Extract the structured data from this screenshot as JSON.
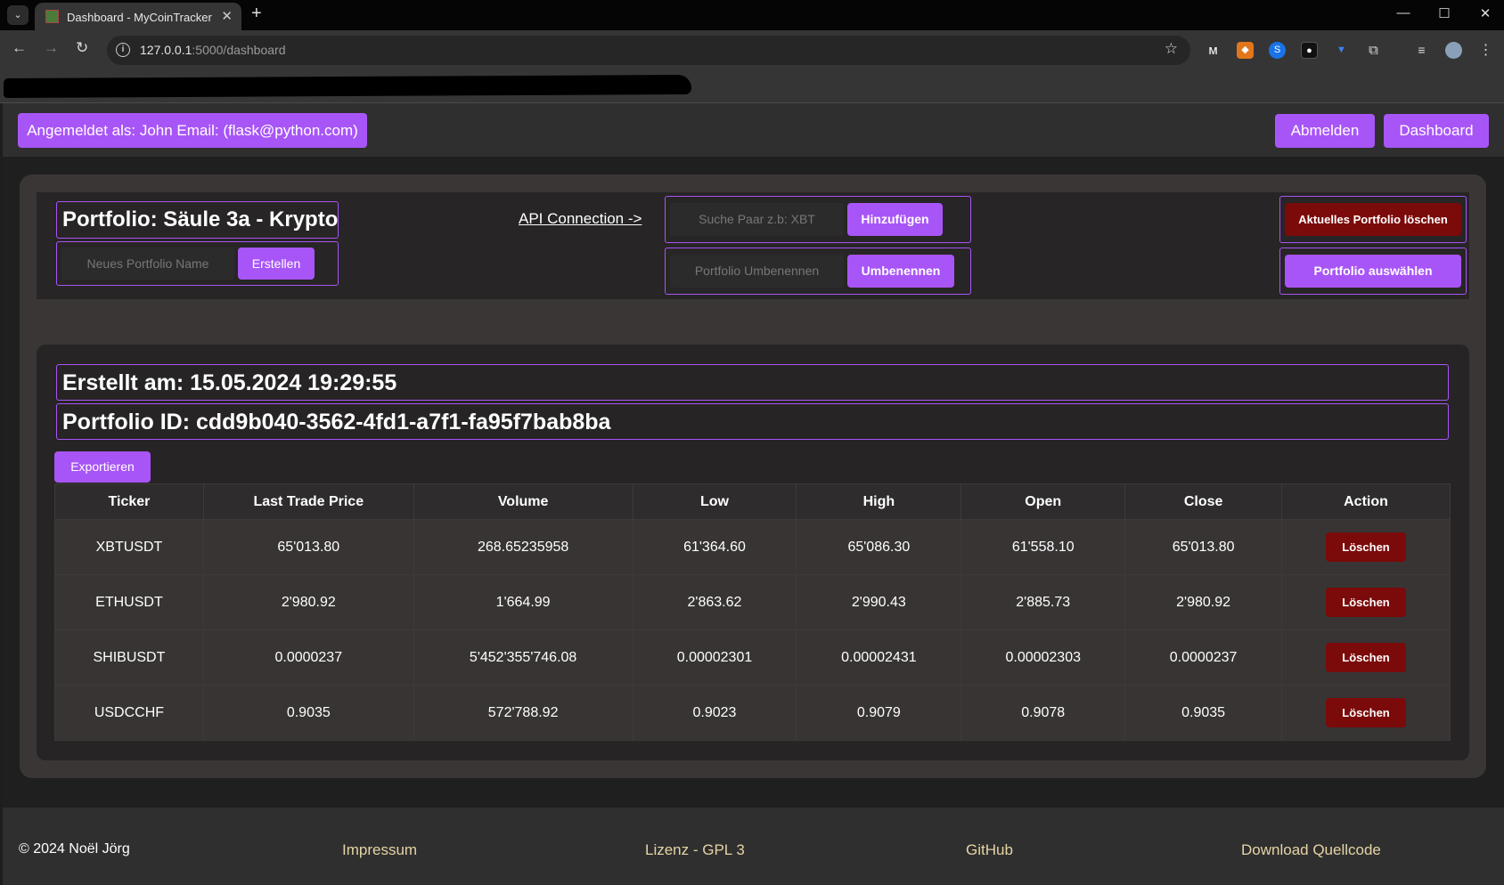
{
  "browser": {
    "tab_title": "Dashboard - MyCoinTracker",
    "url_host": "127.0.0.1",
    "url_path": ":5000/dashboard"
  },
  "header": {
    "user_label": "Angemeldet als: John Email: (flask@python.com)",
    "logout_label": "Abmelden",
    "dashboard_label": "Dashboard"
  },
  "portfolio": {
    "title": "Portfolio: Säule 3a - Krypto",
    "new_name_placeholder": "Neues Portfolio Name",
    "create_label": "Erstellen",
    "api_link": "API Connection ->",
    "search_placeholder": "Suche Paar z.b: XBT",
    "add_label": "Hinzufügen",
    "rename_placeholder": "Portfolio Umbenennen",
    "rename_label": "Umbenennen",
    "delete_label": "Aktuelles Portfolio löschen",
    "select_label": "Portfolio auswählen",
    "created": "Erstellt am: 15.05.2024 19:29:55",
    "id": "Portfolio ID: cdd9b040-3562-4fd1-a7f1-fa95f7bab8ba",
    "export_label": "Exportieren"
  },
  "table": {
    "headers": [
      "Ticker",
      "Last Trade Price",
      "Volume",
      "Low",
      "High",
      "Open",
      "Close",
      "Action"
    ],
    "rows": [
      {
        "ticker": "XBTUSDT",
        "last": "65'013.80",
        "volume": "268.65235958",
        "low": "61'364.60",
        "high": "65'086.30",
        "open": "61'558.10",
        "close": "65'013.80",
        "action": "Löschen"
      },
      {
        "ticker": "ETHUSDT",
        "last": "2'980.92",
        "volume": "1'664.99",
        "low": "2'863.62",
        "high": "2'990.43",
        "open": "2'885.73",
        "close": "2'980.92",
        "action": "Löschen"
      },
      {
        "ticker": "SHIBUSDT",
        "last": "0.0000237",
        "volume": "5'452'355'746.08",
        "low": "0.00002301",
        "high": "0.00002431",
        "open": "0.00002303",
        "close": "0.0000237",
        "action": "Löschen"
      },
      {
        "ticker": "USDCCHF",
        "last": "0.9035",
        "volume": "572'788.92",
        "low": "0.9023",
        "high": "0.9079",
        "open": "0.9078",
        "close": "0.9035",
        "action": "Löschen"
      }
    ]
  },
  "footer": {
    "copyright": "© 2024 Noël Jörg",
    "impressum": "Impressum",
    "license": "Lizenz - GPL 3",
    "github": "GitHub",
    "download": "Download Quellcode"
  },
  "colors": {
    "accent": "#a855f7",
    "danger": "#7b0a0a",
    "footer_link": "#e6d3a4"
  }
}
